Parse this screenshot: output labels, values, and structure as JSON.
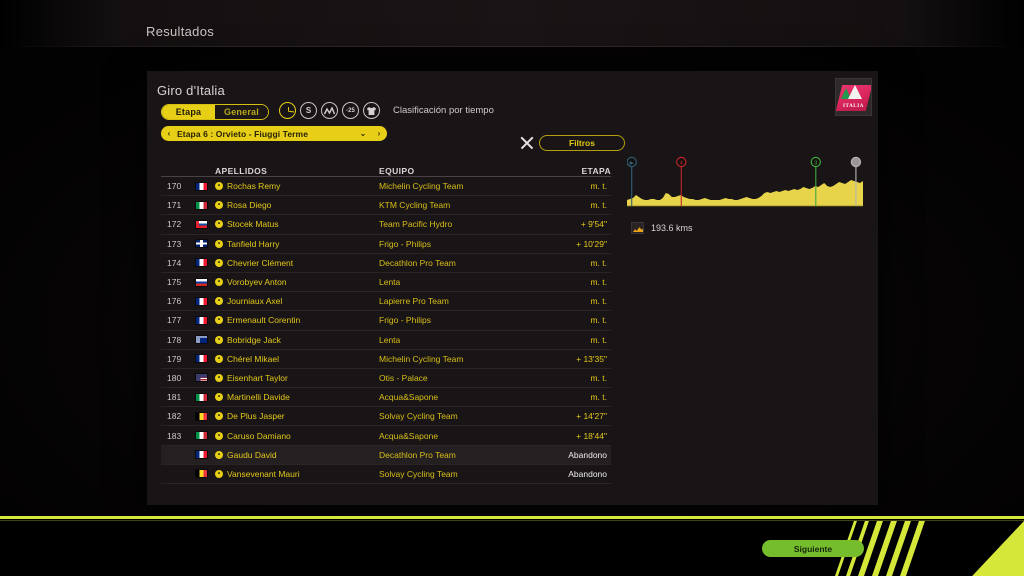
{
  "topbar": {
    "title": "Resultados"
  },
  "panel": {
    "title": "Giro d'Italia",
    "logo": {
      "name": "giro-italia-badge",
      "text": "ITALIA"
    }
  },
  "toggle": {
    "stage_label": "Etapa",
    "general_label": "General",
    "active": "Etapa"
  },
  "classifications": {
    "label": "Clasificación por tiempo",
    "icons": [
      {
        "name": "clock-icon",
        "glyph": "",
        "selected": true
      },
      {
        "name": "sprint-points-icon",
        "glyph": "S",
        "selected": false
      },
      {
        "name": "mountain-icon",
        "glyph": "M",
        "selected": false
      },
      {
        "name": "youth-25-icon",
        "glyph": "-25",
        "selected": false
      },
      {
        "name": "jersey-icon",
        "glyph": "T",
        "selected": false
      }
    ]
  },
  "stage_selector": {
    "value": "Etapa 6 : Orvieto - Fiuggi Terme",
    "prev": "‹",
    "expand": "⌄",
    "next": "›"
  },
  "actions": {
    "close": "✕",
    "filters_label": "Filtros"
  },
  "table": {
    "columns": {
      "rank": "",
      "apellidos": "APELLIDOS",
      "equipo": "EQUIPO",
      "etapa": "ETAPA"
    },
    "rows": [
      {
        "rank": "170",
        "flag": "fr",
        "name": "Rochas Remy",
        "team": "Michelin Cycling Team",
        "time": "m. t.",
        "abandon": false,
        "highlight": false
      },
      {
        "rank": "171",
        "flag": "it",
        "name": "Rosa Diego",
        "team": "KTM Cycling Team",
        "time": "m. t.",
        "abandon": false,
        "highlight": false
      },
      {
        "rank": "172",
        "flag": "sk",
        "name": "Stocek Matus",
        "team": "Team Pacific Hydro",
        "time": "+ 9'54\"",
        "abandon": false,
        "highlight": false
      },
      {
        "rank": "173",
        "flag": "gb",
        "name": "Tanfield Harry",
        "team": "Frigo - Philips",
        "time": "+ 10'29\"",
        "abandon": false,
        "highlight": false
      },
      {
        "rank": "174",
        "flag": "fr",
        "name": "Chevrier Clément",
        "team": "Decathlon Pro Team",
        "time": "m. t.",
        "abandon": false,
        "highlight": false
      },
      {
        "rank": "175",
        "flag": "ru",
        "name": "Vorobyev Anton",
        "team": "Lenta",
        "time": "m. t.",
        "abandon": false,
        "highlight": false
      },
      {
        "rank": "176",
        "flag": "fr",
        "name": "Journiaux Axel",
        "team": "Lapierre Pro Team",
        "time": "m. t.",
        "abandon": false,
        "highlight": false
      },
      {
        "rank": "177",
        "flag": "fr",
        "name": "Ermenault Corentin",
        "team": "Frigo - Philips",
        "time": "m. t.",
        "abandon": false,
        "highlight": false
      },
      {
        "rank": "178",
        "flag": "au",
        "name": "Bobridge Jack",
        "team": "Lenta",
        "time": "m. t.",
        "abandon": false,
        "highlight": false
      },
      {
        "rank": "179",
        "flag": "fr",
        "name": "Chérel Mikael",
        "team": "Michelin Cycling Team",
        "time": "+ 13'35\"",
        "abandon": false,
        "highlight": false
      },
      {
        "rank": "180",
        "flag": "us",
        "name": "Eisenhart Taylor",
        "team": "Otis - Palace",
        "time": "m. t.",
        "abandon": false,
        "highlight": false
      },
      {
        "rank": "181",
        "flag": "it",
        "name": "Martinelli Davide",
        "team": "Acqua&Sapone",
        "time": "m. t.",
        "abandon": false,
        "highlight": false
      },
      {
        "rank": "182",
        "flag": "be",
        "name": "De Plus Jasper",
        "team": "Solvay Cycling Team",
        "time": "+ 14'27\"",
        "abandon": false,
        "highlight": false
      },
      {
        "rank": "183",
        "flag": "it",
        "name": "Caruso Damiano",
        "team": "Acqua&Sapone",
        "time": "+ 18'44\"",
        "abandon": false,
        "highlight": false
      },
      {
        "rank": "",
        "flag": "fr",
        "name": "Gaudu David",
        "team": "Decathlon Pro Team",
        "time": "Abandono",
        "abandon": true,
        "highlight": true
      },
      {
        "rank": "",
        "flag": "be",
        "name": "Vansevenant Mauri",
        "team": "Solvay Cycling Team",
        "time": "Abandono",
        "abandon": true,
        "highlight": false
      }
    ]
  },
  "profile": {
    "distance": "193.6 kms",
    "markers": [
      {
        "name": "start-marker",
        "label": "▶",
        "color": "#2f5f74",
        "x": 2
      },
      {
        "name": "climb-4-marker",
        "label": "4",
        "color": "#c2242a",
        "x": 23
      },
      {
        "name": "climb-3-marker",
        "label": "3",
        "color": "#3fa83f",
        "x": 80
      },
      {
        "name": "finish-marker",
        "label": "",
        "color": "#b9b4b4",
        "x": 97
      }
    ]
  },
  "bottom": {
    "next_label": "Siguiente"
  },
  "colors": {
    "accent_yellow": "#e8cf17",
    "profile_yellow": "#e8d44a",
    "next_green": "#76bd2e",
    "stripe_green": "#d5e83a",
    "panel_bg": "#191516"
  }
}
